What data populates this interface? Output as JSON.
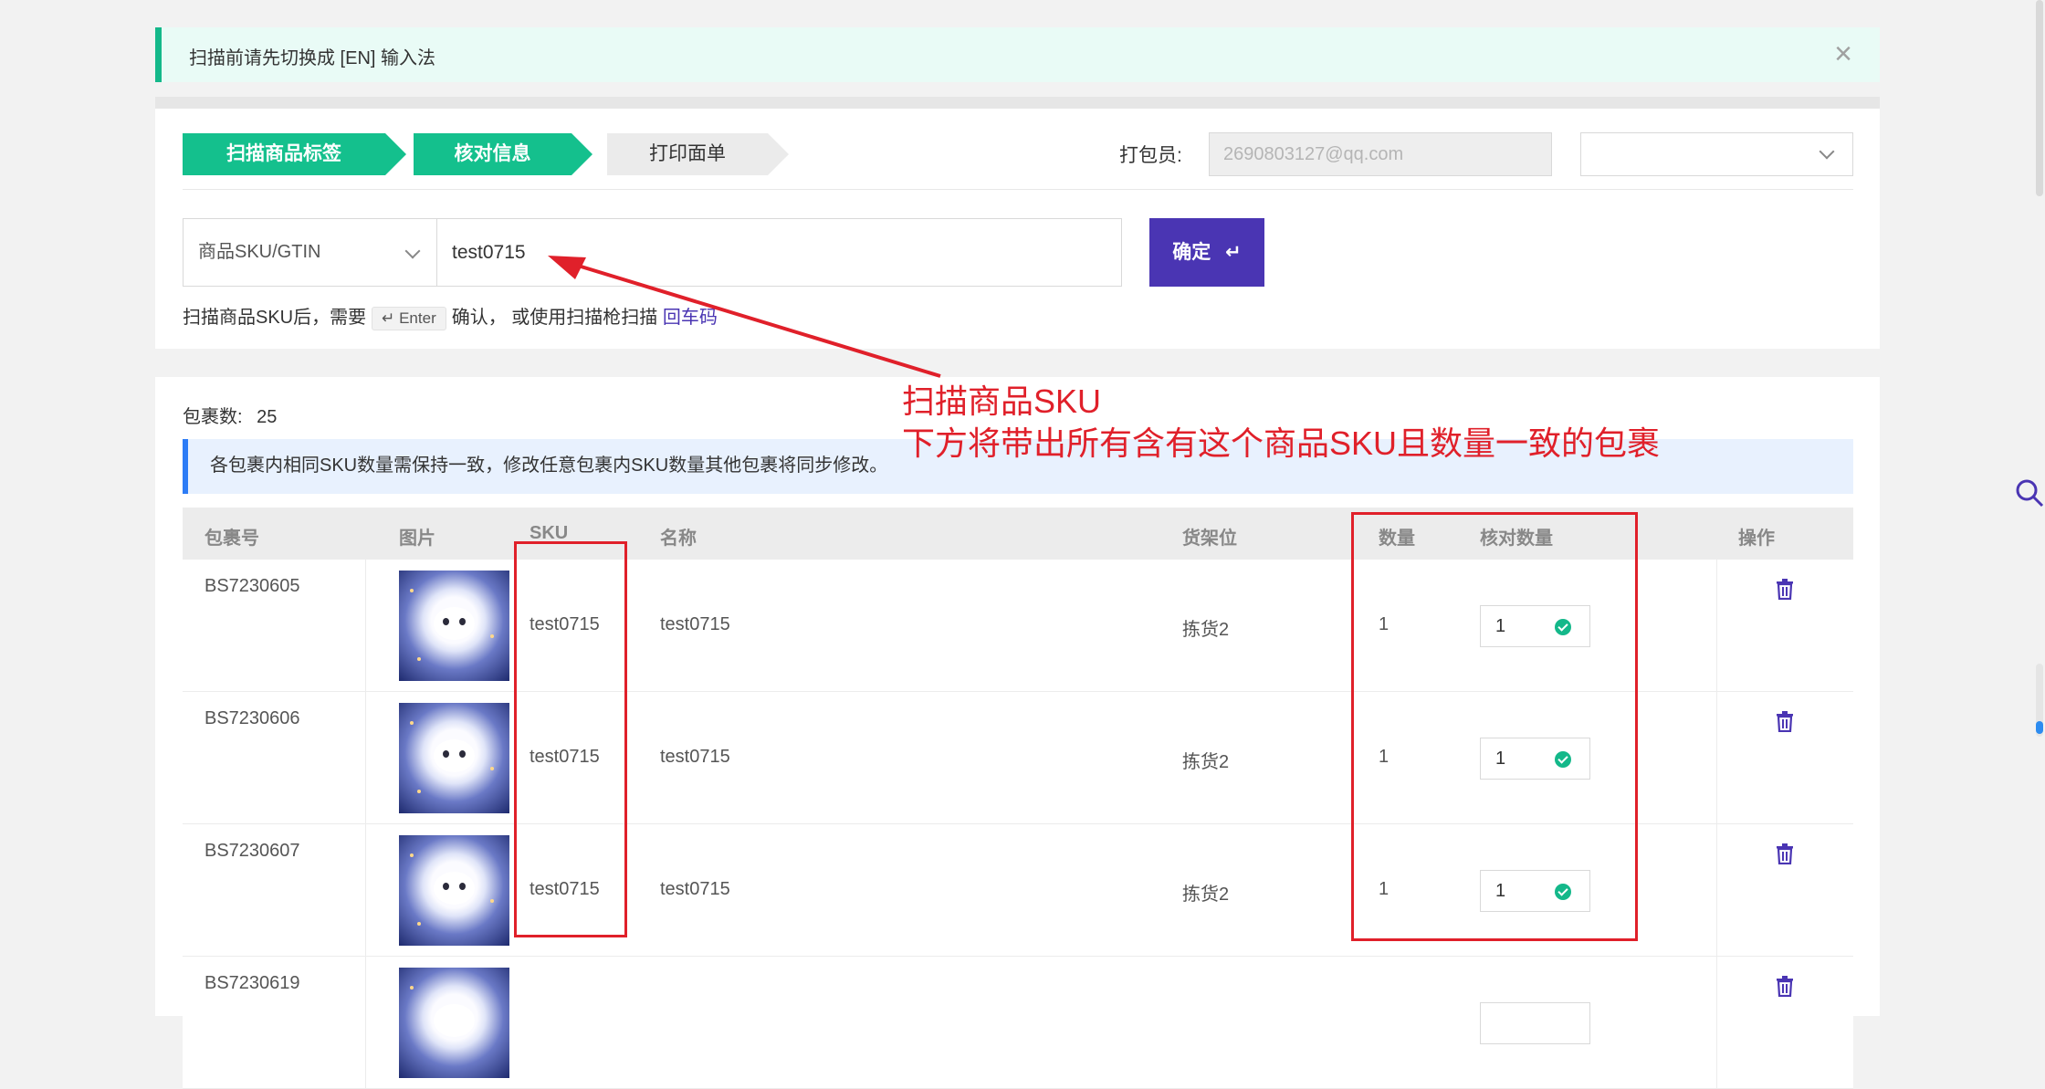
{
  "notice": {
    "text": "扫描前请先切换成 [EN] 输入法",
    "close_glyph": "×"
  },
  "steps": [
    {
      "label": "扫描商品标签",
      "state": "done"
    },
    {
      "label": "核对信息",
      "state": "active"
    },
    {
      "label": "打印面单",
      "state": "pending"
    }
  ],
  "packer": {
    "label": "打包员:",
    "value": "2690803127@qq.com",
    "select_value": ""
  },
  "scan": {
    "type_label": "商品SKU/GTIN",
    "input_value": "test0715",
    "confirm_label": "确定",
    "confirm_glyph": "↵",
    "hint_prefix": "扫描商品SKU后，需要",
    "hint_key": "↵ Enter",
    "hint_mid": "确认， 或使用扫描枪扫描",
    "hint_link": "回车码"
  },
  "packages": {
    "count_label": "包裹数:",
    "count_value": "25",
    "info": "各包裹内相同SKU数量需保持一致，修改任意包裹内SKU数量其他包裹将同步修改。",
    "columns": [
      "包裹号",
      "图片",
      "SKU",
      "名称",
      "货架位",
      "数量",
      "核对数量",
      "操作"
    ],
    "rows": [
      {
        "pkg": "BS7230605",
        "sku": "test0715",
        "name": "test0715",
        "shelf": "拣货2",
        "qty": "1",
        "check_qty": "1"
      },
      {
        "pkg": "BS7230606",
        "sku": "test0715",
        "name": "test0715",
        "shelf": "拣货2",
        "qty": "1",
        "check_qty": "1"
      },
      {
        "pkg": "BS7230607",
        "sku": "test0715",
        "name": "test0715",
        "shelf": "拣货2",
        "qty": "1",
        "check_qty": "1"
      },
      {
        "pkg": "BS7230619",
        "sku": "",
        "name": "",
        "shelf": "",
        "qty": "",
        "check_qty": ""
      }
    ]
  },
  "annotation": {
    "line1": "扫描商品SKU",
    "line2": "下方将带出所有含有这个商品SKU且数量一致的包裹",
    "color": "#e0202a"
  },
  "colors": {
    "primary_green": "#14c08d",
    "confirm_purple": "#4a35b3",
    "info_blue": "#2d7cf6"
  }
}
